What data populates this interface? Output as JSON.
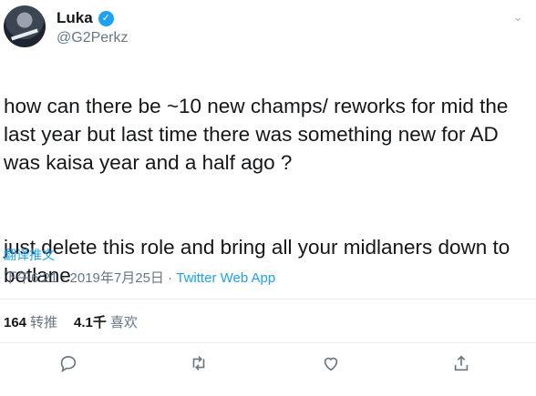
{
  "author": {
    "display_name": "Luka",
    "handle": "@G2Perkz",
    "verified_icon": "verified-badge-icon"
  },
  "tweet": {
    "text_part1": "how can there be ~10 new champs/ reworks for mid the last year but last time there was something new for AD was kaisa year and a half ago ?",
    "text_part2": "just delete this role and bring all your midlaners down to botlane",
    "translate_label": "翻译推文",
    "time": "下午6:21 · 2019年7月25日 · ",
    "source": "Twitter Web App"
  },
  "stats": {
    "retweets_count": "164",
    "retweets_label": "转推",
    "likes_count": "4.1千",
    "likes_label": "喜欢"
  },
  "actions": [
    "reply-icon",
    "retweet-icon",
    "like-icon",
    "share-icon"
  ],
  "colors": {
    "accent": "#1da1f2",
    "text": "#14171a",
    "secondary": "#657786",
    "divider": "#e6ecf0"
  }
}
